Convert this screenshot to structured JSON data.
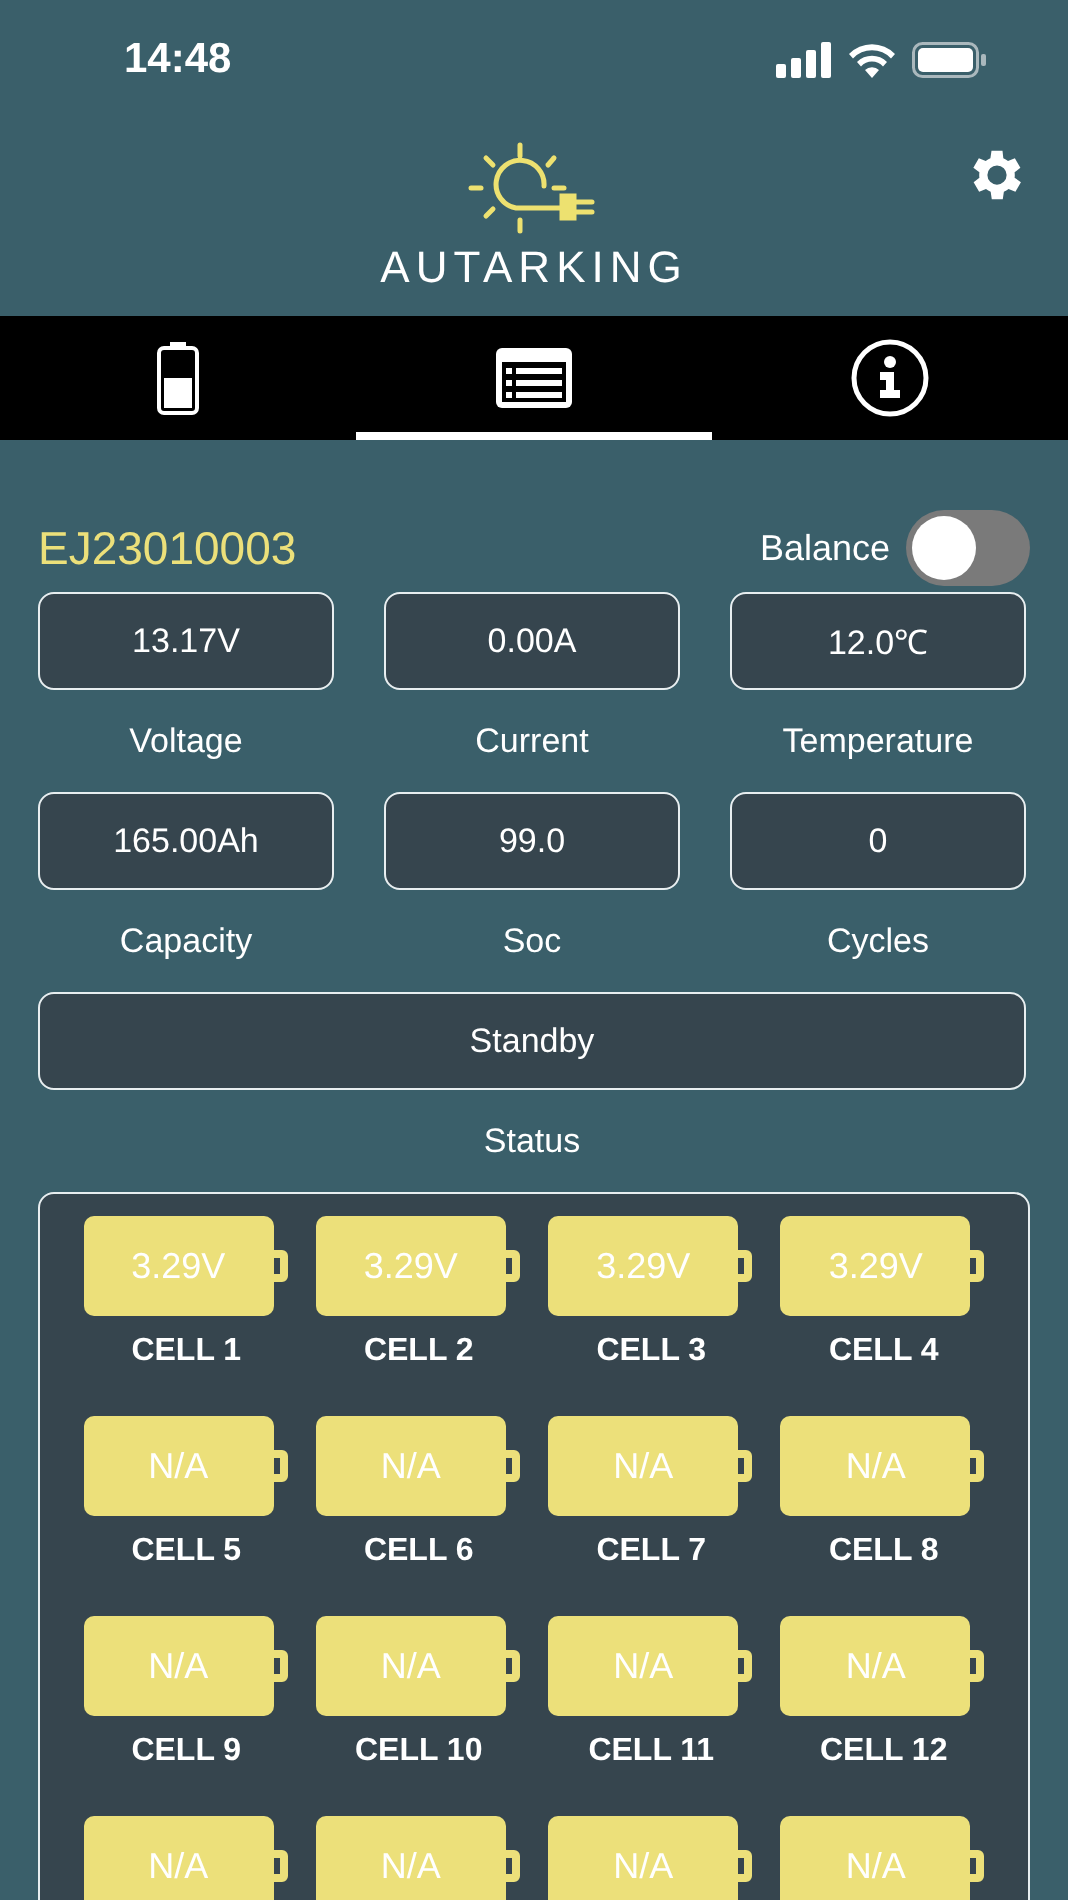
{
  "status_bar": {
    "time": "14:48"
  },
  "header": {
    "brand": "AUTARKING"
  },
  "tabs": [
    {
      "kind": "battery",
      "selected": false
    },
    {
      "kind": "list",
      "selected": true
    },
    {
      "kind": "info",
      "selected": false
    }
  ],
  "device": {
    "name": "EJ23010003",
    "balance_label": "Balance",
    "balance_on": false
  },
  "metrics": [
    {
      "reading": "13.17V",
      "caption": "Voltage",
      "kind": "normal"
    },
    {
      "reading": "0.00A",
      "caption": "Current",
      "kind": "normal"
    },
    {
      "reading": "12.0℃",
      "caption": "Temperature",
      "kind": "normal"
    },
    {
      "reading": "165.00Ah",
      "caption": "Capacity",
      "kind": "normal"
    },
    {
      "reading": "99.0",
      "caption": "Soc",
      "kind": "normal"
    },
    {
      "reading": "0",
      "caption": "Cycles",
      "kind": "normal"
    },
    {
      "reading": "Standby",
      "caption": "Status",
      "kind": "wide"
    }
  ],
  "cells": [
    {
      "value": "3.29V",
      "label": "CELL 1"
    },
    {
      "value": "3.29V",
      "label": "CELL 2"
    },
    {
      "value": "3.29V",
      "label": "CELL 3"
    },
    {
      "value": "3.29V",
      "label": "CELL 4"
    },
    {
      "value": "N/A",
      "label": "CELL 5"
    },
    {
      "value": "N/A",
      "label": "CELL 6"
    },
    {
      "value": "N/A",
      "label": "CELL 7"
    },
    {
      "value": "N/A",
      "label": "CELL 8"
    },
    {
      "value": "N/A",
      "label": "CELL 9"
    },
    {
      "value": "N/A",
      "label": "CELL 10"
    },
    {
      "value": "N/A",
      "label": "CELL 11"
    },
    {
      "value": "N/A",
      "label": "CELL 12"
    },
    {
      "value": "N/A"
    },
    {
      "value": "N/A"
    },
    {
      "value": "N/A"
    },
    {
      "value": "N/A"
    }
  ]
}
